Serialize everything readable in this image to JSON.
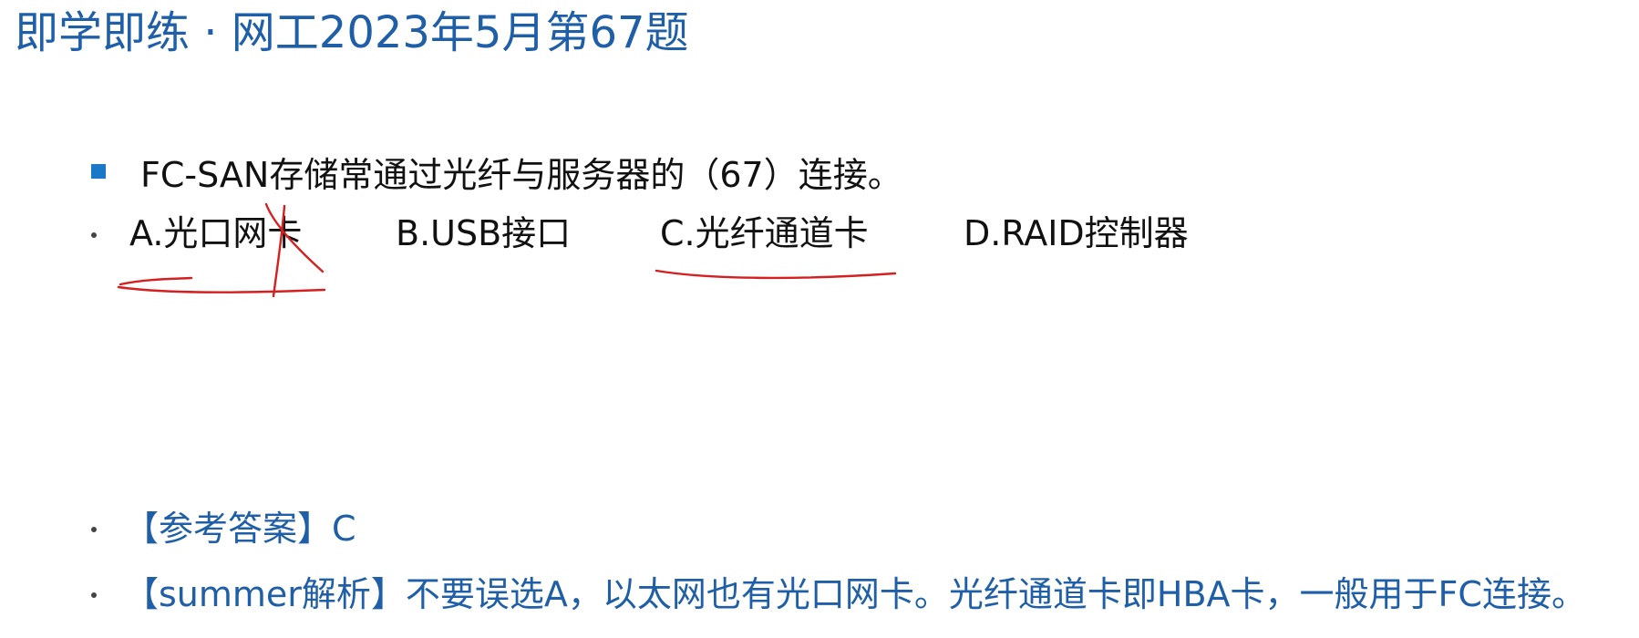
{
  "slide": {
    "title": "即学即练 · 网工2023年5月第67题"
  },
  "question": {
    "text": "FC-SAN存储常通过光纤与服务器的（67）连接。",
    "options": [
      "A.光口网卡",
      "B.USB接口",
      "C.光纤通道卡",
      "D.RAID控制器"
    ]
  },
  "answer": {
    "text": "【参考答案】C"
  },
  "analysis": {
    "text": "【summer解析】不要误选A，以太网也有光口网卡。光纤通道卡即HBA卡，一般用于FC连接。"
  },
  "colors": {
    "title": "#1f5fa8",
    "answer_text": "#1f5fa8",
    "bullet_square": "#1a78c8",
    "annotation_ink": "#d42020"
  }
}
